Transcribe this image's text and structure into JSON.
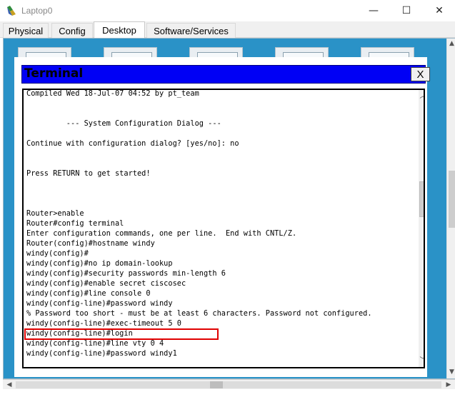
{
  "window": {
    "title": "Laptop0",
    "minimize_symbol": "—",
    "maximize_symbol": "☐",
    "close_symbol": "✕"
  },
  "tabs": [
    {
      "label": "Physical",
      "active": false
    },
    {
      "label": "Config",
      "active": false
    },
    {
      "label": "Desktop",
      "active": true
    },
    {
      "label": "Software/Services",
      "active": false
    }
  ],
  "terminal": {
    "title": "Terminal",
    "close_label": "X",
    "lines": [
      "Compiled Wed 18-Jul-07 04:52 by pt_team",
      "",
      "",
      "         --- System Configuration Dialog ---",
      "",
      "Continue with configuration dialog? [yes/no]: no",
      "",
      "",
      "Press RETURN to get started!",
      "",
      "",
      "",
      "Router>enable",
      "Router#config terminal",
      "Enter configuration commands, one per line.  End with CNTL/Z.",
      "Router(config)#hostname windy",
      "windy(config)#",
      "windy(config)#no ip domain-lookup",
      "windy(config)#security passwords min-length 6",
      "windy(config)#enable secret ciscosec",
      "windy(config)#line console 0",
      "windy(config-line)#password windy",
      "% Password too short - must be at least 6 characters. Password not configured.",
      "windy(config-line)#exec-timeout 5 0",
      "windy(config-line)#login",
      "windy(config-line)#line vty 0 4",
      "windy(config-line)#password windy1"
    ],
    "highlighted_line_index": 23,
    "highlight_color": "#e00000",
    "header_color": "#0000f5"
  },
  "icons": {
    "app": "laptop-app-icon",
    "scroll_up": "chevron-up-icon",
    "scroll_down": "chevron-down-icon",
    "scroll_left": "chevron-left-icon",
    "scroll_right": "chevron-right-icon"
  }
}
